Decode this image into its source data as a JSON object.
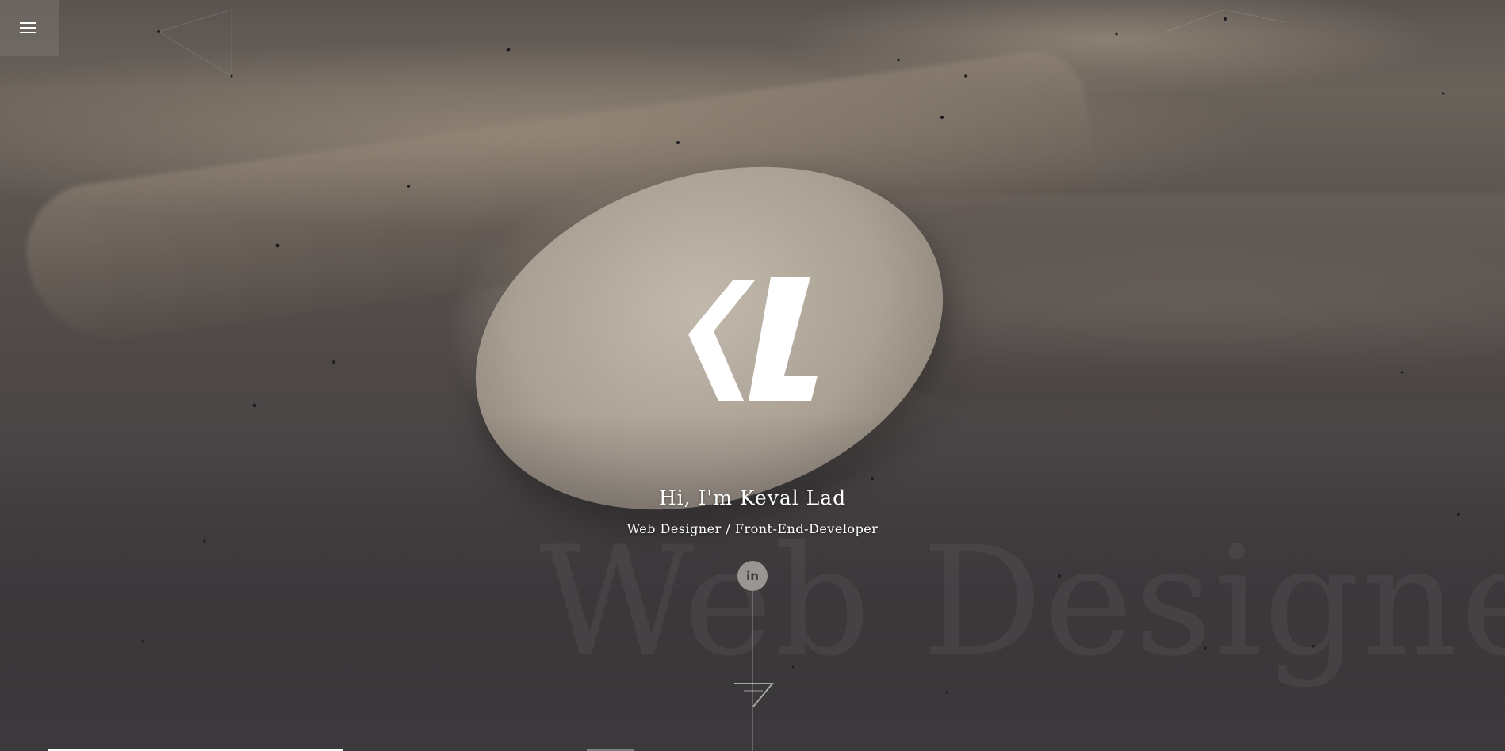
{
  "menu": {
    "icon": "hamburger-menu-icon"
  },
  "hero": {
    "title": "Hi, I'm Keval Lad",
    "subtitle": "Web Designer / Front-End-Developer",
    "background_word": "Web Designer",
    "logo": "kl-logo"
  },
  "social": {
    "linkedin_label": "in",
    "icon": "linkedin-icon"
  },
  "scroll": {
    "icon": "scroll-down-arrow-icon"
  },
  "progress": {
    "fraction": 0.21
  },
  "colors": {
    "text": "#ffffff",
    "background": "#3a3739",
    "social_bg": "#aaa5a2"
  }
}
